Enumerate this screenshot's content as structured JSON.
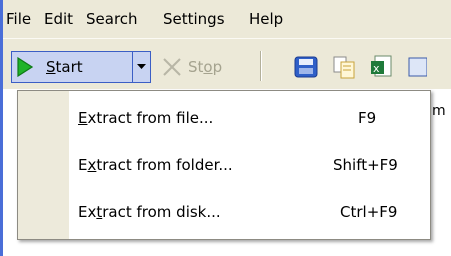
{
  "menubar": {
    "items": [
      {
        "label": "File"
      },
      {
        "label": "Edit"
      },
      {
        "label": "Search"
      },
      {
        "label": "Settings"
      },
      {
        "label": "Help"
      }
    ]
  },
  "toolbar": {
    "start": {
      "before": "",
      "mnemonic": "S",
      "after": "tart"
    },
    "stop": {
      "before": "St",
      "mnemonic": "o",
      "after": "p"
    },
    "icons": [
      "save-icon",
      "copy-icon",
      "excel-export-icon"
    ]
  },
  "dropdown": {
    "items": [
      {
        "before": "",
        "mnemonic": "E",
        "after": "xtract from file...",
        "shortcut": "F9"
      },
      {
        "before": "E",
        "mnemonic": "x",
        "after": "tract from folder...",
        "shortcut": "Shift+F9"
      },
      {
        "before": "Ex",
        "mnemonic": "t",
        "after": "ract from disk...",
        "shortcut": "Ctrl+F9"
      }
    ]
  },
  "partial_text": "m",
  "colors": {
    "chrome": "#ece9d8",
    "highlight_border": "#3b5ec5",
    "highlight_fill": "#c8d3f2",
    "play_green": "#1fb32a",
    "disabled_text": "#a5a38f"
  }
}
